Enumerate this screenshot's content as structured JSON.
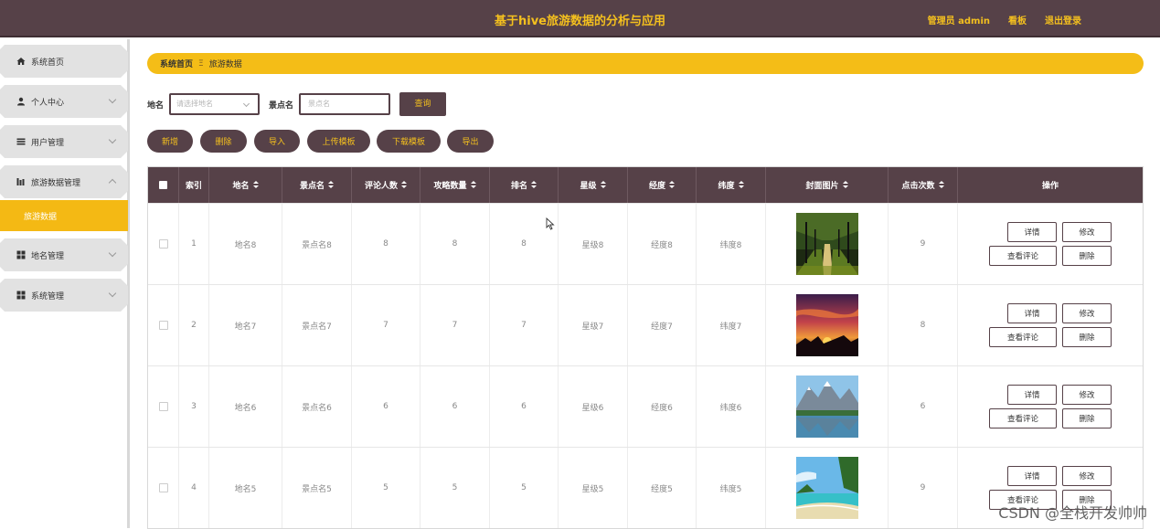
{
  "header": {
    "title": "基于hive旅游数据的分析与应用",
    "nav": [
      "管理员 admin",
      "看板",
      "退出登录"
    ]
  },
  "sidebar": {
    "items": [
      {
        "label": "系统首页",
        "icon": "home-icon",
        "has_arrow": false
      },
      {
        "label": "个人中心",
        "icon": "user-icon",
        "has_arrow": true
      },
      {
        "label": "用户管理",
        "icon": "list-icon",
        "has_arrow": true
      },
      {
        "label": "旅游数据管理",
        "icon": "chart-icon",
        "has_arrow": true,
        "expanded": true
      },
      {
        "label": "地名管理",
        "icon": "grid-icon",
        "has_arrow": true
      },
      {
        "label": "系统管理",
        "icon": "grid-icon",
        "has_arrow": true
      }
    ],
    "active_submenu": "旅游数据"
  },
  "breadcrumb": {
    "home": "系统首页",
    "separator": "Ξ",
    "current": "旅游数据"
  },
  "search": {
    "place_label": "地名",
    "place_placeholder": "请选择地名",
    "spot_label": "景点名",
    "spot_placeholder": "景点名",
    "query_button": "查询"
  },
  "actions": [
    "新增",
    "删除",
    "导入",
    "上传模板",
    "下载模板",
    "导出"
  ],
  "table": {
    "columns": [
      "索引",
      "地名",
      "景点名",
      "评论人数",
      "攻略数量",
      "排名",
      "星级",
      "经度",
      "纬度",
      "封面图片",
      "点击次数",
      "操作"
    ],
    "rows": [
      {
        "index": "1",
        "place": "地名8",
        "spot": "景点名8",
        "comments": "8",
        "guides": "8",
        "rank": "8",
        "star": "星级8",
        "lng": "经度8",
        "lat": "纬度8",
        "image": "forest-road",
        "clicks": "9"
      },
      {
        "index": "2",
        "place": "地名7",
        "spot": "景点名7",
        "comments": "7",
        "guides": "7",
        "rank": "7",
        "star": "星级7",
        "lng": "经度7",
        "lat": "纬度7",
        "image": "sunset",
        "clicks": "8"
      },
      {
        "index": "3",
        "place": "地名6",
        "spot": "景点名6",
        "comments": "6",
        "guides": "6",
        "rank": "6",
        "star": "星级6",
        "lng": "经度6",
        "lat": "纬度6",
        "image": "mountain-lake",
        "clicks": "6"
      },
      {
        "index": "4",
        "place": "地名5",
        "spot": "景点名5",
        "comments": "5",
        "guides": "5",
        "rank": "5",
        "star": "星级5",
        "lng": "经度5",
        "lat": "纬度5",
        "image": "beach",
        "clicks": "9"
      }
    ],
    "row_ops": [
      "详情",
      "修改",
      "查看评论",
      "删除"
    ]
  },
  "watermark": "CSDN @全栈开发帅帅",
  "colors": {
    "primary": "#564148",
    "accent": "#f4bd17",
    "accent_text": "#f4c01e"
  }
}
